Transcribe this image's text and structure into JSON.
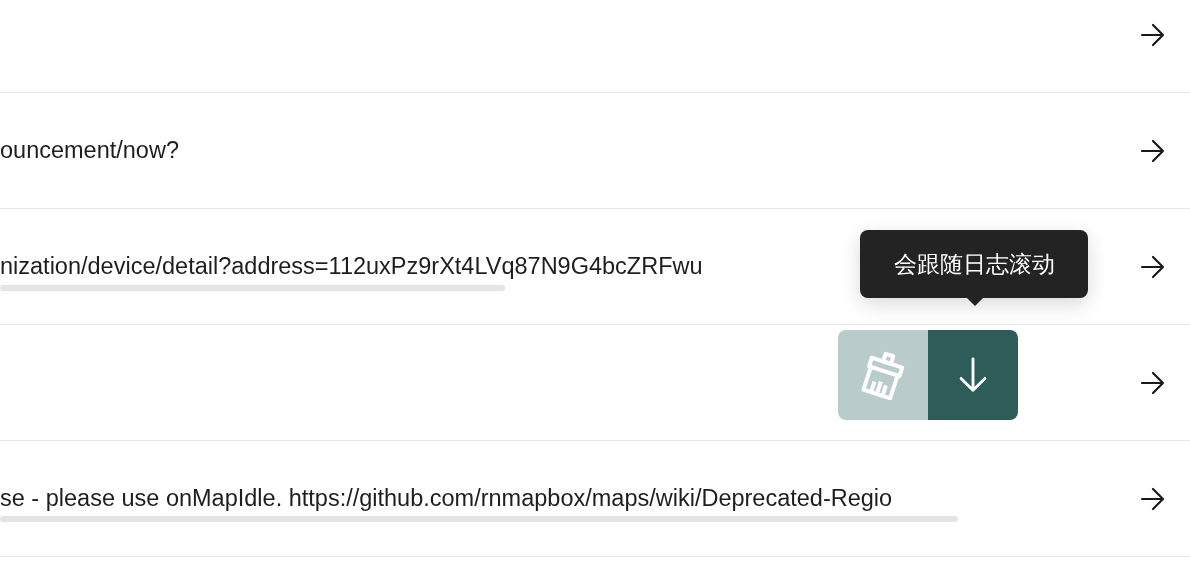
{
  "rows": [
    {
      "kind": "blank",
      "scrollbar": false
    },
    {
      "kind": "text",
      "text": "ouncement/now?",
      "scrollbar": false
    },
    {
      "kind": "text",
      "text": "nization/device/detail?address=112uxPz9rXt4LVq87N9G4bcZRFwu",
      "scrollbar": true
    },
    {
      "kind": "blank",
      "scrollbar": false
    },
    {
      "kind": "text",
      "text": "se - please use onMapIdle. https://github.com/rnmapbox/maps/wiki/Deprecated-Regio",
      "scrollbar": true
    }
  ],
  "tooltip": {
    "text": "会跟随日志滚动"
  },
  "controls": [
    {
      "kind": "clear",
      "disabled": true
    },
    {
      "kind": "scroll-down",
      "disabled": false
    }
  ]
}
